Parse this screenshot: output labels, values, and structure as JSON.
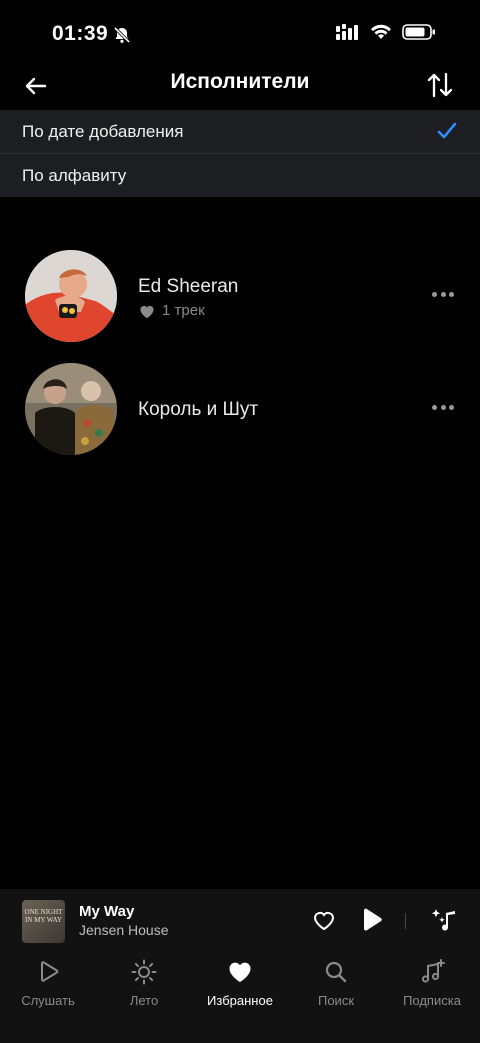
{
  "status": {
    "time": "01:39"
  },
  "header": {
    "title": "Исполнители"
  },
  "sort_menu": {
    "options": [
      {
        "label": "По дате добавления",
        "selected": true
      },
      {
        "label": "По алфавиту",
        "selected": false
      }
    ],
    "accent": "#2f8cff"
  },
  "artists": [
    {
      "name": "Ed Sheeran",
      "liked_tracks": "1 трек"
    },
    {
      "name": "Король и Шут",
      "liked_tracks": ""
    }
  ],
  "mini_player": {
    "cover_text": "ONE NIGHT IN MY WAY",
    "title": "My Way",
    "artist": "Jensen House"
  },
  "tabs": [
    {
      "label": "Слушать",
      "icon": "play-icon",
      "active": false
    },
    {
      "label": "Лето",
      "icon": "sun-icon",
      "active": false
    },
    {
      "label": "Избранное",
      "icon": "heart-icon",
      "active": true
    },
    {
      "label": "Поиск",
      "icon": "search-icon",
      "active": false
    },
    {
      "label": "Подписка",
      "icon": "music-plus-icon",
      "active": false
    }
  ]
}
